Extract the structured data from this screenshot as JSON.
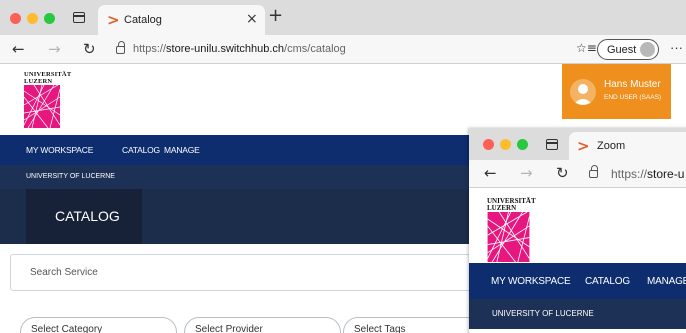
{
  "browser": {
    "tab_title": "Catalog",
    "close_glyph": "×",
    "new_tab_glyph": "+",
    "url_prefix": "https://",
    "url_host": "store-unilu.switchhub.ch",
    "url_path": "/cms/catalog",
    "profile_label": "Guest",
    "more_glyph": "···",
    "back_glyph": "←",
    "forward_glyph": "→",
    "reload_glyph": "↻",
    "favorites_glyph": "☆≡",
    "traffic_light_colors": [
      "#fe5f57",
      "#febc2e",
      "#28c840"
    ]
  },
  "site": {
    "logo_line1": "UNIVERSITÄT",
    "logo_line2": "LUZERN",
    "user_name": "Hans Muster",
    "user_role": "END USER (SAAS)",
    "nav": [
      "MY WORKSPACE",
      "CATALOG",
      "MANAGE"
    ],
    "org_name": "UNIVERSITY OF LUCERNE",
    "page_title": "CATALOG",
    "search_placeholder": "Search Service",
    "filters": [
      "Select Category",
      "Select Provider",
      "Select Tags"
    ],
    "colors": {
      "brand_navy": "#0d2d6e",
      "subnav": "#1d3157",
      "hero": "#1c2c4b",
      "user_orange": "#ef8f1d",
      "logo_magenta": "#e6187f"
    }
  },
  "zoom_window": {
    "tab_title": "Zoom",
    "url_prefix": "https://",
    "url_host_visible": "store-u",
    "nav": [
      "MY WORKSPACE",
      "CATALOG",
      "MANAGE"
    ],
    "org_name": "UNIVERSITY OF LUCERNE",
    "logo_line1": "UNIVERSITÄT",
    "logo_line2": "LUZERN"
  }
}
